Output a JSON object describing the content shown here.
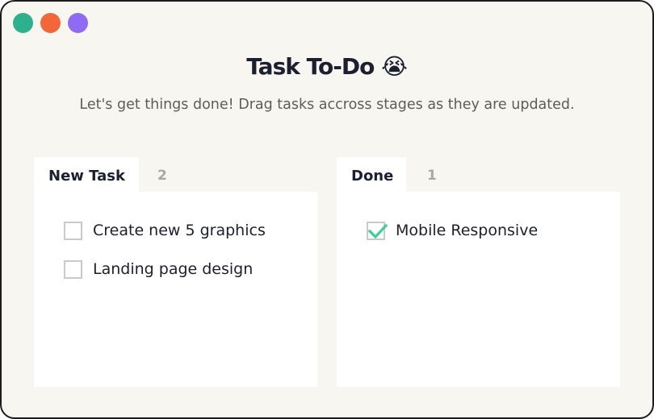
{
  "window": {
    "controls": [
      {
        "name": "green",
        "color": "#2eb08f"
      },
      {
        "name": "orange",
        "color": "#f2663a"
      },
      {
        "name": "purple",
        "color": "#8f6bf3"
      }
    ]
  },
  "header": {
    "title": "Task To-Do",
    "title_emoji": "😭",
    "subtitle": "Let's get things done! Drag tasks accross stages as they are updated."
  },
  "columns": [
    {
      "name": "New Task",
      "count": "2",
      "tasks": [
        {
          "label": "Create new 5 graphics",
          "done": false
        },
        {
          "label": "Landing page design",
          "done": false
        }
      ]
    },
    {
      "name": "Done",
      "count": "1",
      "tasks": [
        {
          "label": "Mobile Responsive",
          "done": true
        }
      ]
    }
  ],
  "colors": {
    "check": "#3ecf95",
    "checkbox_border": "#c9c9c9"
  }
}
